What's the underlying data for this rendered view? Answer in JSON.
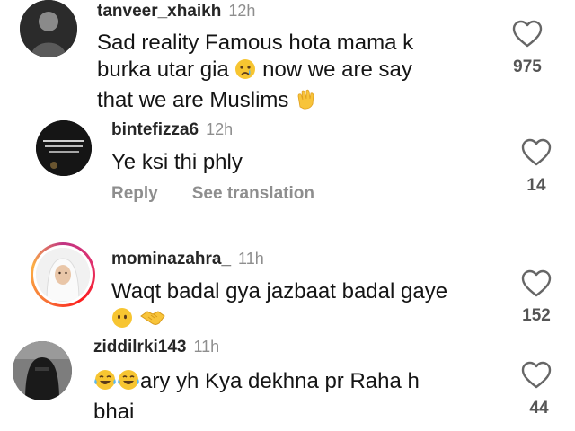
{
  "comments": [
    {
      "username": "tanveer_xhaikh",
      "time": "12h",
      "text_line1": "Sad reality Famous hota mama k",
      "text_line2a": "burka utar gia",
      "text_line2b": "now we are say",
      "text_line3": "that we are Muslims",
      "likes": "975",
      "emoji": [
        "crying-face",
        "clapping-hands"
      ]
    },
    {
      "username": "bintefizza6",
      "time": "12h",
      "text_line1": "Ye ksi thi phly",
      "reply_label": "Reply",
      "translate_label": "See translation",
      "likes": "14"
    },
    {
      "username": "mominazahra_",
      "time": "11h",
      "text_line1": "Waqt badal gya jazbaat badal gaye",
      "likes": "152",
      "emoji": [
        "no-mouth-face",
        "handshake"
      ]
    },
    {
      "username": "ziddilrki143",
      "time": "11h",
      "text_line1": "ary yh Kya dekhna pr Raha h",
      "text_line2": "bhai",
      "likes": "44",
      "emoji": [
        "tears-of-joy",
        "tears-of-joy"
      ]
    }
  ],
  "icons": {
    "like": "heart-outline-icon"
  }
}
